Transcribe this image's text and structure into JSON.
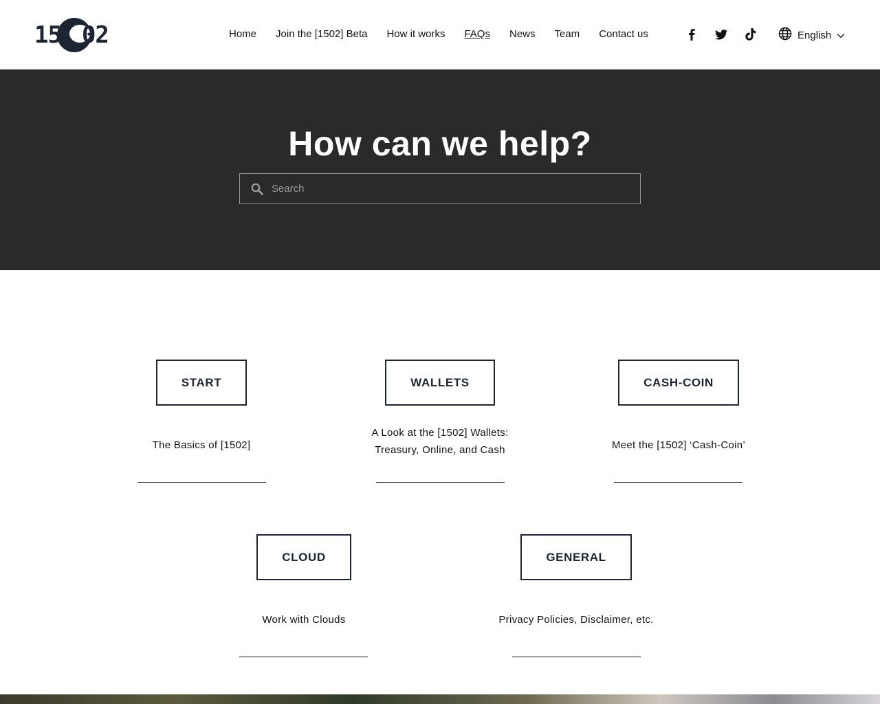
{
  "logo": {
    "left": "15",
    "right": "02"
  },
  "nav": {
    "items": [
      {
        "label": "Home",
        "active": false
      },
      {
        "label": "Join the [1502] Beta",
        "active": false
      },
      {
        "label": "How it works",
        "active": false
      },
      {
        "label": "FAQs",
        "active": true
      },
      {
        "label": "News",
        "active": false
      },
      {
        "label": "Team",
        "active": false
      },
      {
        "label": "Contact us",
        "active": false
      }
    ]
  },
  "socials": [
    "facebook-icon",
    "twitter-icon",
    "tiktok-icon"
  ],
  "language": {
    "label": "English"
  },
  "hero": {
    "title": "How can we help?",
    "search_placeholder": "Search"
  },
  "categories": [
    {
      "button": "START",
      "description": "The Basics of [1502]"
    },
    {
      "button": "WALLETS",
      "description": "A Look at the [1502] Wallets: Treasury, Online, and Cash"
    },
    {
      "button": "CASH-COIN",
      "description": "Meet the [1502] ‘Cash-Coin’"
    },
    {
      "button": "CLOUD",
      "description": "Work with Clouds"
    },
    {
      "button": "GENERAL",
      "description": "Privacy Policies, Disclaimer, etc."
    }
  ],
  "colors": {
    "hero_bg": "#2b2a2b",
    "accent": "#1d2533"
  }
}
